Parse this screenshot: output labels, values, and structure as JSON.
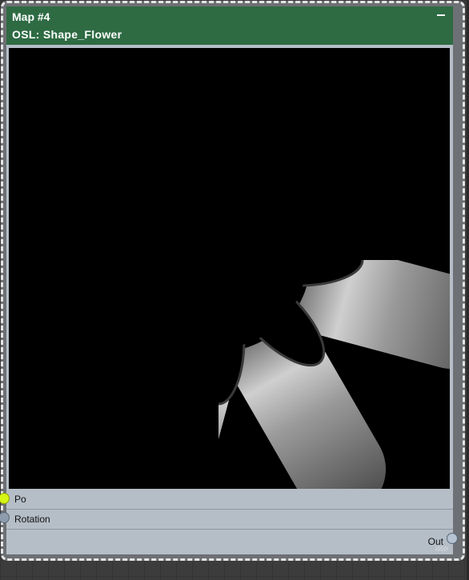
{
  "node": {
    "title": "Map #4",
    "subtitle": "OSL: Shape_Flower",
    "minimize_icon": "minimize-icon"
  },
  "ports": {
    "inputs": [
      {
        "label": "Po",
        "color": "#d4f515"
      },
      {
        "label": "Rotation",
        "color": "#8e9cae"
      }
    ],
    "output": {
      "label": "Out",
      "color": "#b4c2d2"
    }
  },
  "colors": {
    "header": "#2e6b43",
    "node_body": "#b5bec7",
    "background": "#3c3c3c"
  }
}
